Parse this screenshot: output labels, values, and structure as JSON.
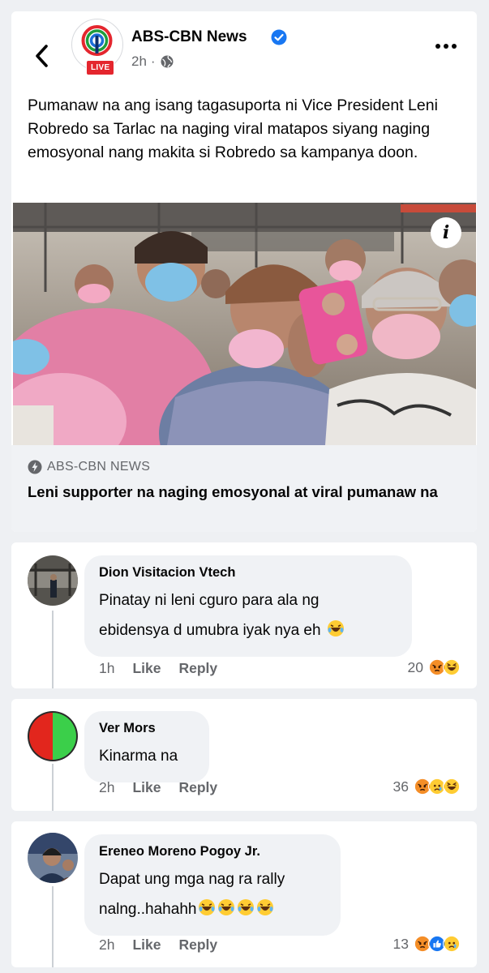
{
  "post": {
    "page_name": "ABS-CBN News",
    "live_badge": "LIVE",
    "time": "2h",
    "text": "Pumanaw na ang isang tagasuporta ni Vice President Leni Robredo sa Tarlac na naging viral matapos siyang naging emosyonal nang makita si Robredo sa kampanya doon.",
    "link_source": "ABS-CBN NEWS",
    "link_title": "Leni supporter na naging emosyonal at viral pumanaw na"
  },
  "comments": [
    {
      "name": "Dion Visitacion Vtech",
      "line1": "Pinatay ni leni cguro para ala ng",
      "line2": "ebidensya d umubra iyak nya eh",
      "time": "1h",
      "like": "Like",
      "reply": "Reply",
      "reaction_count": "20"
    },
    {
      "name": "Ver Mors",
      "line1": "Kinarma na",
      "time": "2h",
      "like": "Like",
      "reply": "Reply",
      "reaction_count": "36"
    },
    {
      "name": "Ereneo Moreno Pogoy Jr.",
      "line1": "Dapat ung mga nag ra rally",
      "line2": "nalng..hahahh",
      "time": "2h",
      "like": "Like",
      "reply": "Reply",
      "reaction_count": "13"
    }
  ],
  "icons": {
    "back": "chevron-left-icon",
    "verified": "verified-badge-icon",
    "privacy": "globe-icon",
    "more": "more-options-icon",
    "info": "info-icon",
    "source": "lightning-icon",
    "laugh": "laughing-emoji-icon",
    "angry": "angry-reaction-icon",
    "haha": "haha-reaction-icon",
    "sad": "sad-reaction-icon",
    "like": "like-reaction-icon"
  },
  "colors": {
    "accent": "#1877f2",
    "secondary_text": "#65676b",
    "live_red": "#e4262e"
  }
}
